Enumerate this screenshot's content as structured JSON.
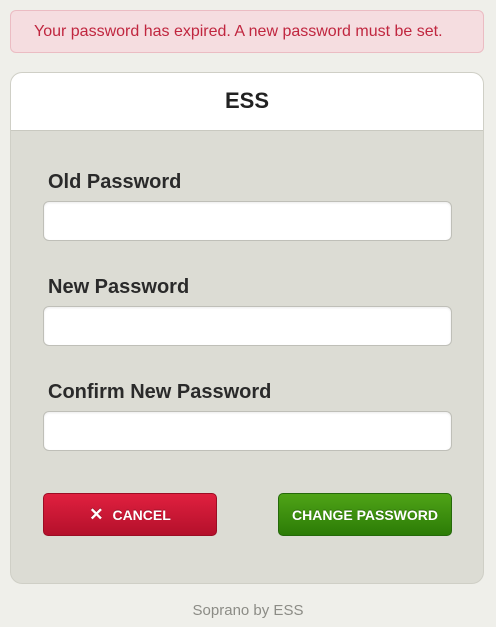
{
  "alert": {
    "message": "Your password has expired. A new password must be set."
  },
  "card": {
    "title": "ESS"
  },
  "form": {
    "old_password_label": "Old Password",
    "old_password_value": "",
    "new_password_label": "New Password",
    "new_password_value": "",
    "confirm_password_label": "Confirm New Password",
    "confirm_password_value": ""
  },
  "buttons": {
    "cancel_label": "CANCEL",
    "cancel_icon": "x-icon",
    "change_password_label": "CHANGE PASSWORD"
  },
  "footer": {
    "text": "Soprano by ESS"
  },
  "colors": {
    "alert_text": "#c0263f",
    "cancel": "#c8142f",
    "change_password": "#3a8d0d"
  }
}
